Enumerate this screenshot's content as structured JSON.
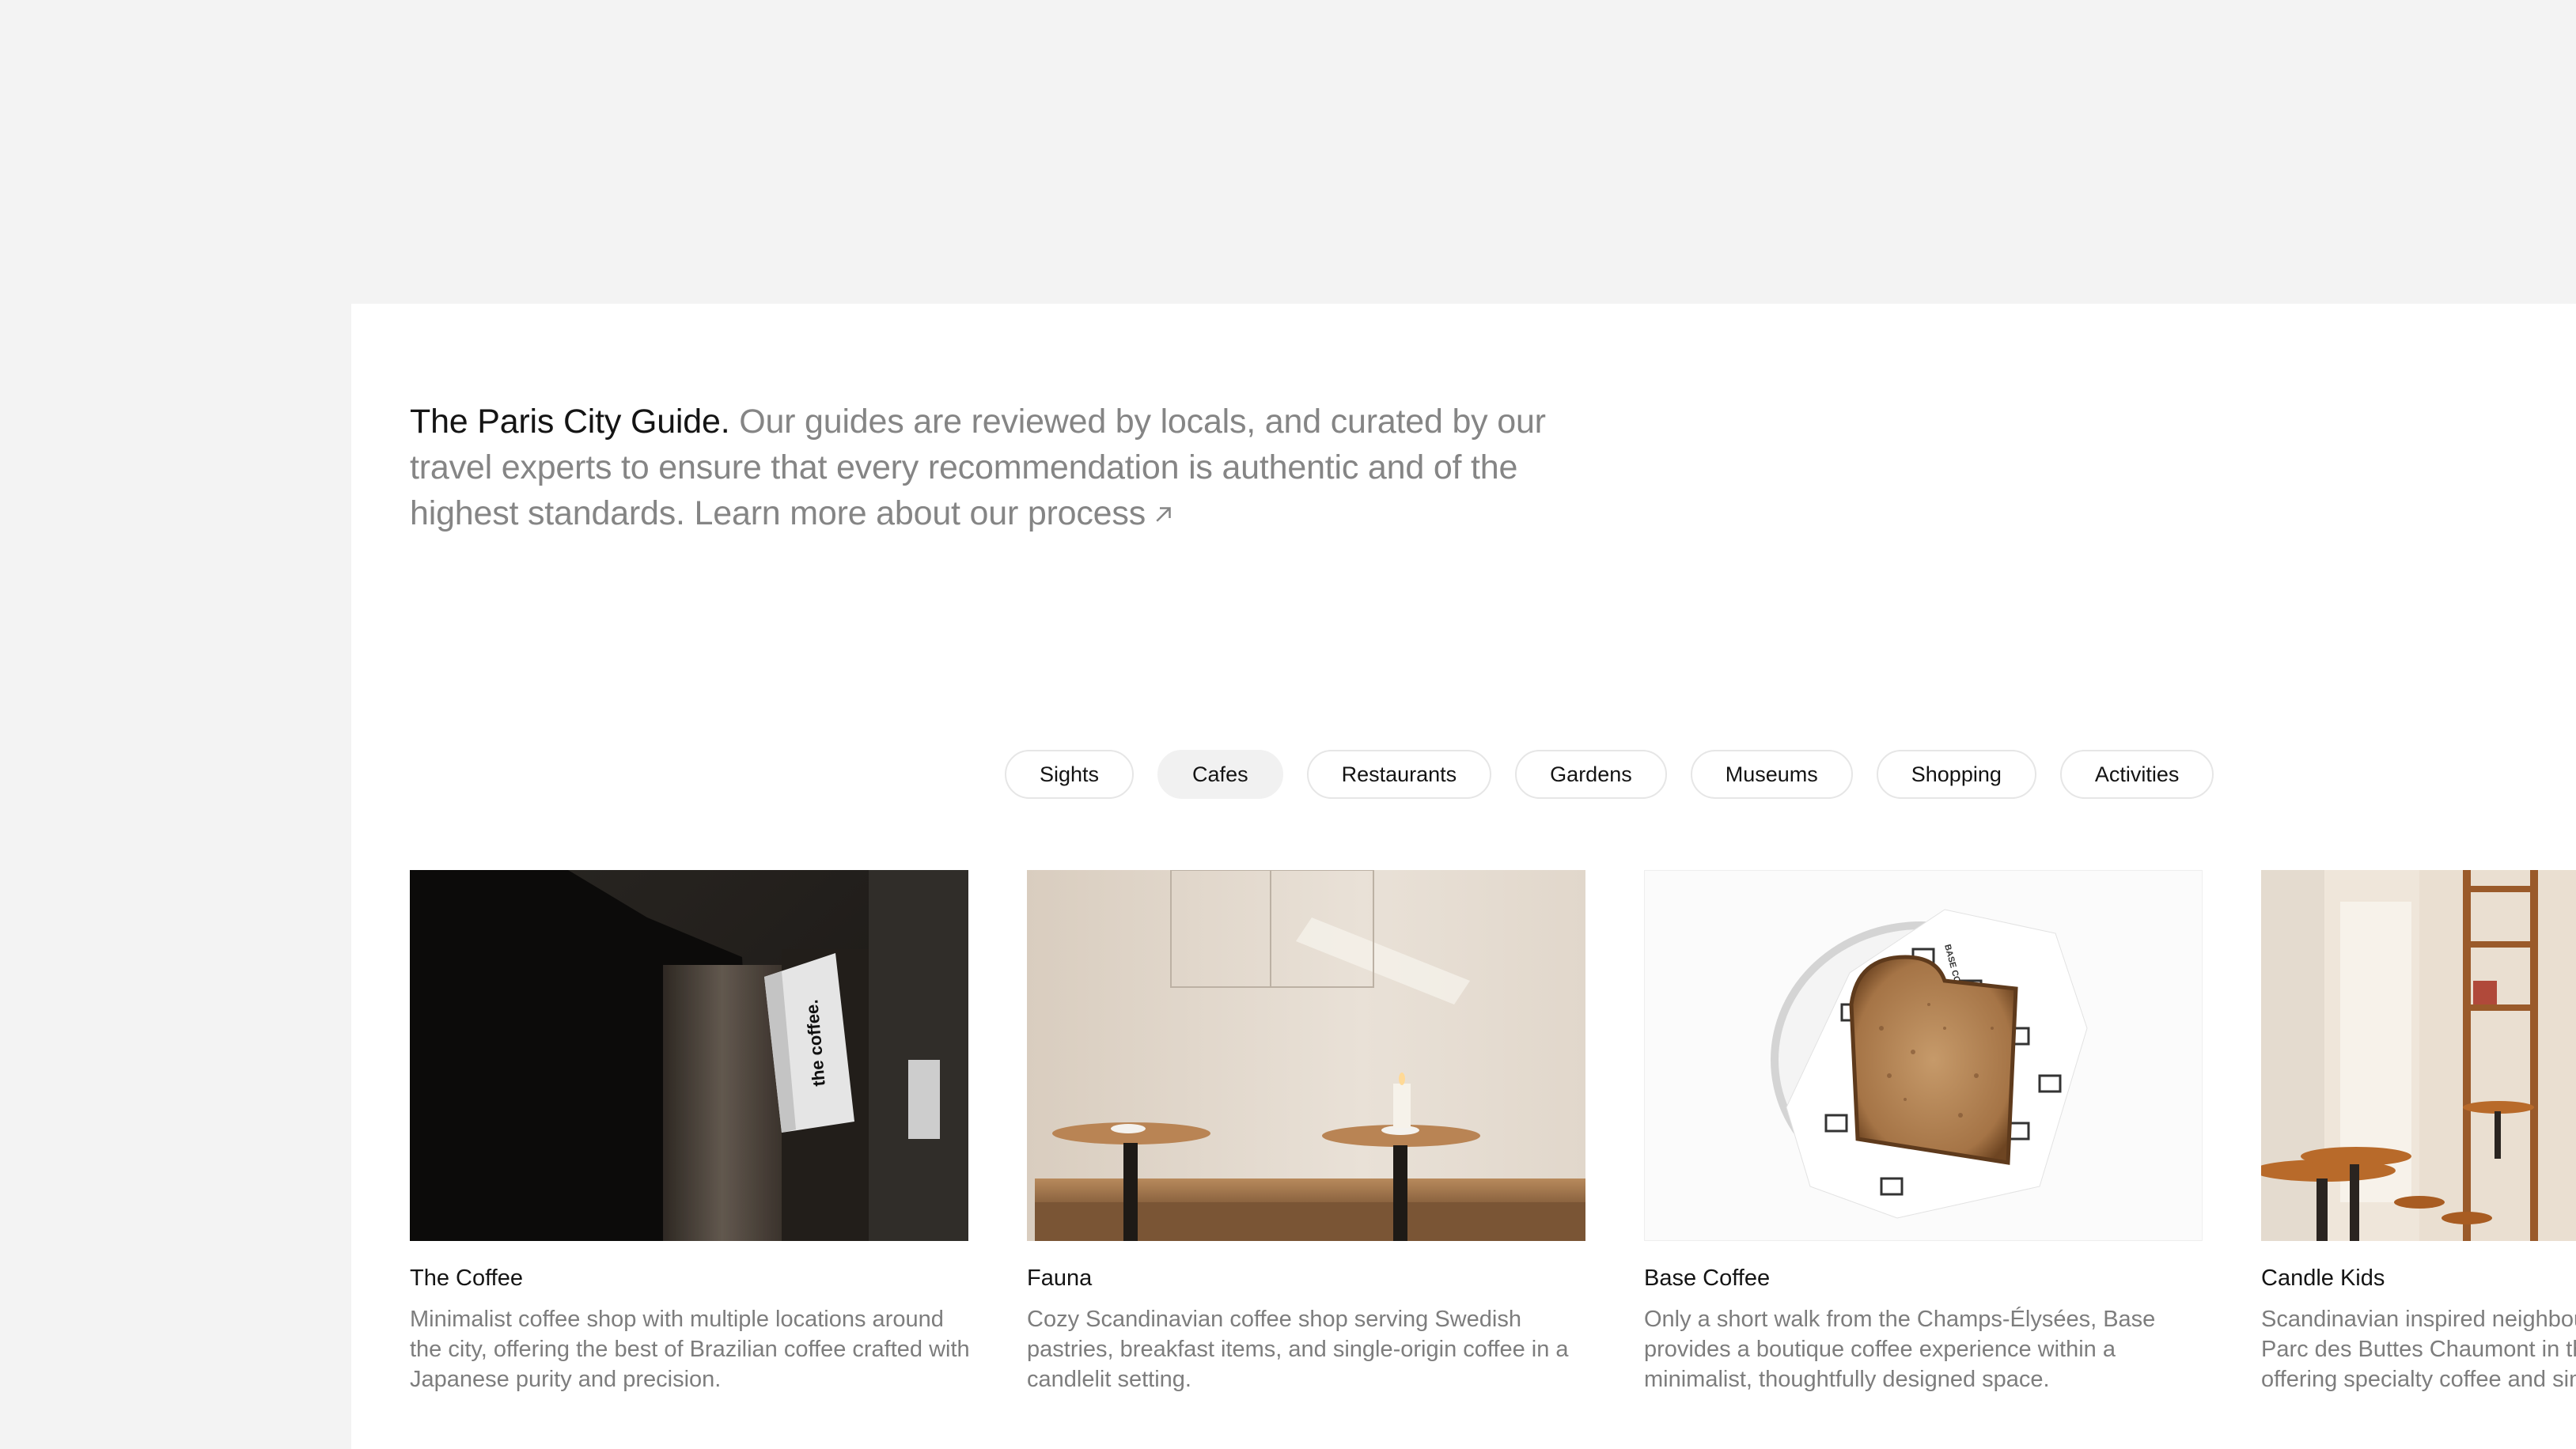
{
  "intro": {
    "lead": "The Paris City Guide.",
    "body": " Our guides are reviewed by locals, and curated by our travel experts to ensure that every recommendation is authentic and of the highest standards. ",
    "link": "Learn more about our process"
  },
  "filters": [
    "Sights",
    "Cafes",
    "Restaurants",
    "Gardens",
    "Museums",
    "Shopping",
    "Activities"
  ],
  "active_filter": "Cafes",
  "cards": [
    {
      "title": "The Coffee",
      "desc": "Minimalist coffee shop with multiple locations around the city, offering the best of Brazilian coffee crafted with Japanese purity and precision.",
      "sign_text": "the coffee."
    },
    {
      "title": "Fauna",
      "desc": "Cozy Scandinavian coffee shop serving Swedish pastries, breakfast items, and single-origin coffee in a candlelit setting."
    },
    {
      "title": "Base Coffee",
      "desc": "Only a short walk from the Champs-Élysées, Base provides a boutique coffee experience within a minimalist, thoughtfully designed space.",
      "wrapper_text": "BASE COFFEE"
    },
    {
      "title": "Candle Kids",
      "desc": "Scandinavian inspired neighbourhood café near the Parc des Buttes Chaumont in the 19th arrondissement, offering specialty coffee and simple food."
    }
  ],
  "colors": {
    "background": "#f3f3f3",
    "panel": "#ffffff",
    "text_primary": "#141414",
    "text_secondary": "#858585",
    "chip_border": "#e6e6e6",
    "chip_active": "#f1f1f1"
  }
}
